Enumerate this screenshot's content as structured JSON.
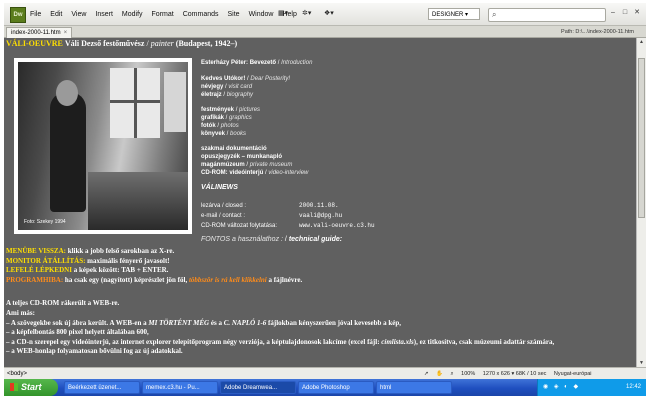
{
  "app": {
    "logo": "Dw",
    "menus": [
      "File",
      "Edit",
      "View",
      "Insert",
      "Modify",
      "Format",
      "Commands",
      "Site",
      "Window",
      "Help"
    ],
    "workspace": "DESIGNER ▾",
    "search_placeholder": ""
  },
  "tab": {
    "filename": "index-2000-11.htm",
    "path": "Path:  D:\\...\\index-2000-11.htm"
  },
  "page": {
    "header_yellow": "VÁLI-OEUVRE",
    "header_name": "Váli Dezső festőművész",
    "header_role": "painter",
    "header_place": "(Budapest, 1942–)",
    "photo_caption": "Foto: Szekey  1994",
    "links": [
      {
        "hu": "Esterházy Péter: Bevezető",
        "en": "Introduction"
      },
      {
        "hu": "Kedves Utókor!",
        "en": "Dear Posterity!"
      },
      {
        "hu": "névjegy",
        "en": "visit card"
      },
      {
        "hu": "életrajz",
        "en": "biography"
      },
      {
        "hu": "festmények",
        "en": "pictures"
      },
      {
        "hu": "grafikák",
        "en": "graphics"
      },
      {
        "hu": "fotók",
        "en": "photos"
      },
      {
        "hu": "könyvek",
        "en": "books"
      }
    ],
    "docs_title": "szakmai dokumentáció",
    "docs_links": [
      {
        "hu": "opuszjegyzék – munkanapló",
        "en": ""
      },
      {
        "hu": "magánmúzeum",
        "en": "private museum"
      },
      {
        "hu": "CD-ROM: videóinterjú",
        "en": "video-interview"
      }
    ],
    "news_title": "VÁLINEWS",
    "news": {
      "closed_label": "lezárva / closed :",
      "closed_value": "2000.11.08.",
      "email_label": "e-mail / contact :",
      "email_value": "vaali@dpg.hu",
      "cd_label": "CD-ROM változat folytatása:",
      "cd_value": "www.vali-oeuvre.c3.hu"
    },
    "fonts_text": "FONTOS a használathoz :",
    "fonts_bold": "technical guide:",
    "bottom": {
      "line1_b": "MENÜBE VISSZA:",
      "line1": " klikk a jobb felső sarokban az X-re.",
      "line2_b": "MONITOR ÁTÁLLÍTÁS:",
      "line2": " maximális fényerő javasolt!",
      "line3_b": "LEFELÉ LÉPKEDNI",
      "line3": " a képek között: TAB + ENTER.",
      "line4_o": "PROGRAMHIBA:",
      "line4_a": " ha csak egy (nagyított) képrészlet jön föl, ",
      "line4_oi": "többször is rá kell klikkelni",
      "line4_b": " a fájlnévre.",
      "para1": "A teljes CD-ROM rákerült a WEB-re.",
      "para2": "Ami más:",
      "para3_a": "– A szövegekbe sok új ábra került. A WEB-en a ",
      "para3_i": "MI TÖRTÉNT MÉG",
      "para3_b": " és a ",
      "para3_i2": "C. NAPLÓ 1-6",
      "para3_c": " fájlokban kényszerűen jóval kevesebb a kép,",
      "para4": "– a képfelbontás 800 pixel helyett általában 600,",
      "para5_a": "– a CD-n szerepel egy videóinterjú, az internet explorer telepítőprogram négy verziója, a képtulajdonosok lakcíme (excel fájl: ",
      "para5_i": "címlista.xls",
      "para5_b": "), ez titkosítva, csak múzeumi adattár számára,",
      "para6": "– a WEB-honlap folyamatosan bővülni fog az új adatokkal."
    }
  },
  "status": {
    "tag": "<body>",
    "zoom": "100%",
    "dims": "1270 x 626 ▾  68K / 10 sec",
    "encoding": "Nyugat-európai"
  },
  "taskbar": {
    "start": "Start",
    "tasks": [
      "Beérkezett üzenet...",
      "memex.c3.hu - Pu...",
      "Adobe Dreamwea...",
      "Adobe Photoshop",
      "html"
    ],
    "clock": "12:42"
  }
}
